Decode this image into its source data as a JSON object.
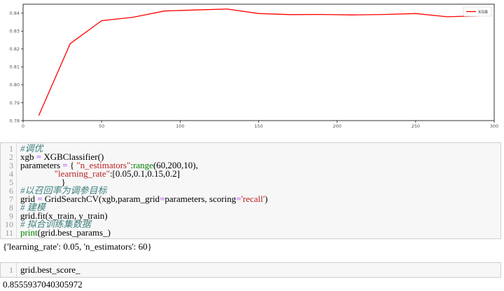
{
  "chart_data": {
    "type": "line",
    "title": "",
    "xlabel": "",
    "ylabel": "",
    "xlim": [
      0,
      300
    ],
    "ylim": [
      0.78,
      0.845
    ],
    "xticks": [
      0,
      50,
      100,
      150,
      200,
      250,
      300
    ],
    "yticks": [
      0.78,
      0.79,
      0.8,
      0.81,
      0.82,
      0.83,
      0.84
    ],
    "ytick_labels": [
      "0.78",
      "0.79",
      "0.80",
      "0.81",
      "0.82",
      "0.83",
      "0.84"
    ],
    "grid": false,
    "legend_position": "top-right",
    "series": [
      {
        "name": "XGB",
        "color": "#ff0000",
        "x": [
          10,
          30,
          50,
          70,
          90,
          110,
          130,
          150,
          170,
          190,
          210,
          230,
          250,
          270,
          290
        ],
        "values": [
          0.7828,
          0.823,
          0.8358,
          0.8377,
          0.8412,
          0.8418,
          0.8423,
          0.8398,
          0.8392,
          0.8393,
          0.839,
          0.8393,
          0.8398,
          0.838,
          0.8385
        ]
      }
    ]
  },
  "cell1": {
    "lines": [
      {
        "n": "1",
        "parts": [
          {
            "t": "#调优",
            "c": "cm"
          }
        ]
      },
      {
        "n": "2",
        "parts": [
          {
            "t": "xgb ",
            "c": ""
          },
          {
            "t": "=",
            "c": "op"
          },
          {
            "t": " XGBClassifier()",
            "c": ""
          }
        ]
      },
      {
        "n": "3",
        "parts": [
          {
            "t": "parameters ",
            "c": ""
          },
          {
            "t": "=",
            "c": "op"
          },
          {
            "t": " { ",
            "c": ""
          },
          {
            "t": "\"n_estimators\"",
            "c": "str"
          },
          {
            "t": ":",
            "c": ""
          },
          {
            "t": "range",
            "c": "bi"
          },
          {
            "t": "(60,200,10),",
            "c": ""
          }
        ]
      },
      {
        "n": "4",
        "parts": [
          {
            "t": "               ",
            "c": ""
          },
          {
            "t": "\"learning_rate\"",
            "c": "str"
          },
          {
            "t": ":[0.05,0.1,0.15,0.2]",
            "c": ""
          }
        ]
      },
      {
        "n": "5",
        "parts": [
          {
            "t": "                  }",
            "c": ""
          }
        ]
      },
      {
        "n": "6",
        "parts": [
          {
            "t": "#以召回率为调参目标",
            "c": "cm"
          }
        ]
      },
      {
        "n": "7",
        "parts": [
          {
            "t": "grid ",
            "c": ""
          },
          {
            "t": "=",
            "c": "op"
          },
          {
            "t": " GridSearchCV(xgb,param_grid",
            "c": ""
          },
          {
            "t": "=",
            "c": "op"
          },
          {
            "t": "parameters, scoring",
            "c": ""
          },
          {
            "t": "=",
            "c": "op"
          },
          {
            "t": "'recall'",
            "c": "str"
          },
          {
            "t": ")",
            "c": ""
          }
        ]
      },
      {
        "n": "8",
        "parts": [
          {
            "t": "# 建模",
            "c": "cm"
          }
        ]
      },
      {
        "n": "9",
        "parts": [
          {
            "t": "grid.fit(x_train, y_train)",
            "c": ""
          }
        ]
      },
      {
        "n": "10",
        "parts": [
          {
            "t": "# 拟合训练集数据",
            "c": "cm"
          }
        ]
      },
      {
        "n": "11",
        "parts": [
          {
            "t": "print",
            "c": "bi"
          },
          {
            "t": "(grid.best_params_)",
            "c": ""
          }
        ]
      }
    ]
  },
  "output1": "{'learning_rate': 0.05, 'n_estimators': 60}",
  "cell2": {
    "lines": [
      {
        "n": "1",
        "parts": [
          {
            "t": "grid.best_score_",
            "c": ""
          }
        ]
      }
    ]
  },
  "output2": "0.8555937040305972"
}
